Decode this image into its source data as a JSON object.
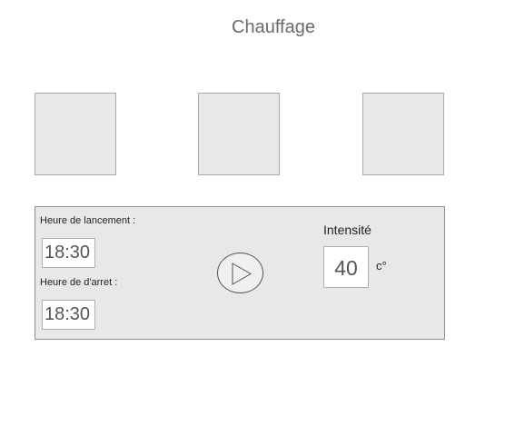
{
  "header": {
    "title": "Chauffage"
  },
  "tiles": [
    {
      "id": "tile-1"
    },
    {
      "id": "tile-2"
    },
    {
      "id": "tile-3"
    }
  ],
  "schedule": {
    "start_label": "Heure de lancement :",
    "start_value": "18:30",
    "stop_label": "Heure de d'arret :",
    "stop_value": "18:30"
  },
  "intensity": {
    "label": "Intensité",
    "value": "40",
    "unit": "c°"
  },
  "icons": {
    "play": "play-icon"
  },
  "colors": {
    "panel_bg": "#e8e8e8",
    "tile_bg": "#e8e8e8",
    "field_bg": "#ffffff"
  }
}
